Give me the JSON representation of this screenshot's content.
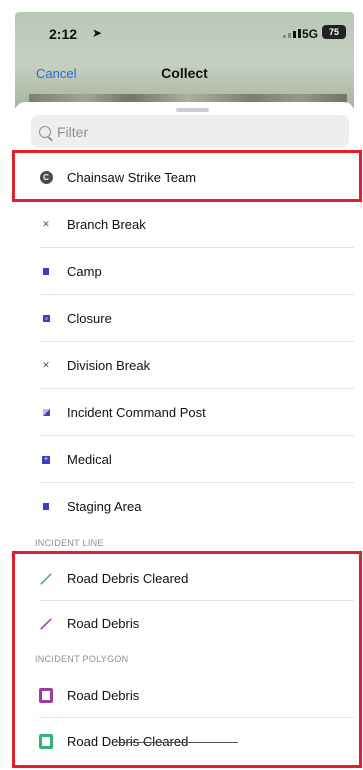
{
  "status_bar": {
    "time": "2:12",
    "network": "5G",
    "battery": "75"
  },
  "nav": {
    "cancel_label": "Cancel",
    "title": "Collect"
  },
  "filter": {
    "placeholder": "Filter"
  },
  "items": [
    {
      "label": "Chainsaw Strike Team",
      "icon": "circle-c-icon"
    },
    {
      "label": "Branch Break",
      "icon": "x-mark-icon"
    },
    {
      "label": "Camp",
      "icon": "square-icon"
    },
    {
      "label": "Closure",
      "icon": "square-outline-icon"
    },
    {
      "label": "Division Break",
      "icon": "x-mark-icon"
    },
    {
      "label": "Incident Command Post",
      "icon": "half-square-icon"
    },
    {
      "label": "Medical",
      "icon": "plus-square-icon"
    },
    {
      "label": "Staging Area",
      "icon": "square-icon"
    }
  ],
  "sections": {
    "incident_line": {
      "title": "INCIDENT LINE",
      "items": [
        {
          "label": "Road Debris Cleared",
          "icon": "green-line-icon",
          "color": "#34b27a"
        },
        {
          "label": "Road Debris",
          "icon": "purple-line-icon",
          "color": "#9c3e9c"
        }
      ]
    },
    "incident_polygon": {
      "title": "INCIDENT POLYGON",
      "items": [
        {
          "label": "Road Debris",
          "icon": "purple-polygon-icon",
          "color": "#9c3e9c"
        },
        {
          "label": "Road Debris Cleared",
          "icon": "green-polygon-icon",
          "color": "#34b27a"
        }
      ]
    }
  },
  "colors": {
    "accent": "#2c6bd4",
    "highlight": "#e3202a",
    "point_symbol": "#3a3fc8"
  }
}
